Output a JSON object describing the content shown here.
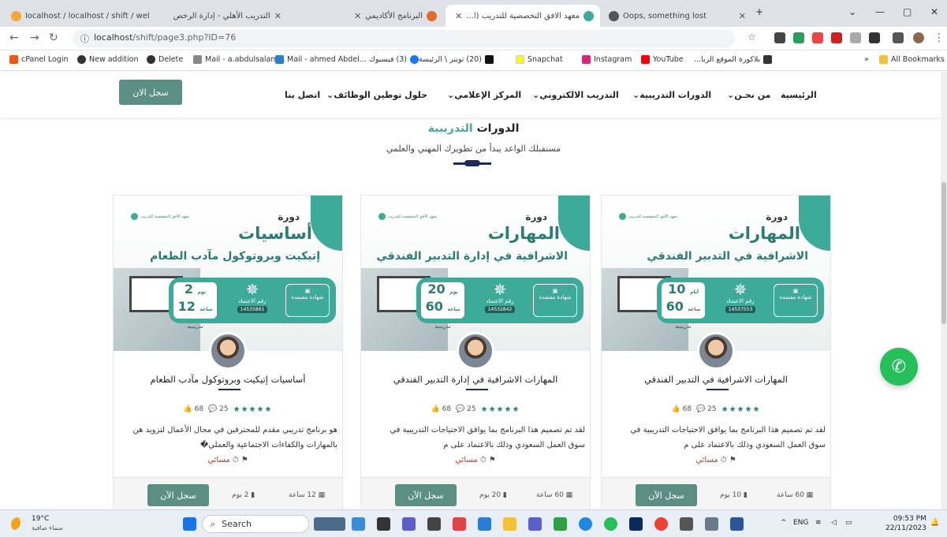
{
  "browser": {
    "tabs": [
      {
        "title": "localhost / localhost / shift / wel",
        "fav": "#f3a93a"
      },
      {
        "title": "التدريب الأهلي - إدارة الرخص",
        "fav": "#888"
      },
      {
        "title": "البرنامج الأكاديمي",
        "fav": "#e36b2c"
      },
      {
        "title": "معهد الافق التخصصية للتدريب (ا...",
        "fav": "#3eaa9a"
      },
      {
        "title": "Oops, something lost",
        "fav": "#555"
      }
    ],
    "url_host": "localhost",
    "url_path": "/shift/page3.php?ID=76",
    "bookmarks": [
      "cPanel Login",
      "New addition",
      "Delete",
      "Mail - a.abdulsalam...",
      "Mail - ahmed Abdel...",
      "(3) فيسبوك",
      "(20) تويتر \\ الرئيسة",
      "Snapchat",
      "Instagram",
      "YouTube",
      "بلاكورة الموقع الربا..."
    ],
    "bookmark_colors": [
      "#e8591a",
      "#333",
      "#333",
      "#555",
      "#2b7cd3",
      "#1877f2",
      "#111",
      "#fffc00",
      "#d62976",
      "#ff0000",
      "#333"
    ],
    "all_bookmarks": "All Bookmarks",
    "more": "»"
  },
  "site": {
    "menu": [
      "الرئيسية",
      "من نحـن",
      "الدورات التدريبية",
      "التدريب الالكتروني",
      "المركز الإعلامي",
      "حلول توطين الوظائف",
      "اتصل بنا"
    ],
    "register": "سجل الان",
    "heading_a": "الدورات",
    "heading_b": "التدريبية",
    "subheading": "مستقبلك الواعد يبدأ من تطويرك المهني والعلمي"
  },
  "cards": [
    {
      "b_title": "المهارات",
      "b_sub": "الاشرافية في التدبير الفندقي",
      "b_days": "10",
      "b_days_unit": "أيام",
      "b_hours": "60",
      "b_hours_unit": "ساعة تدريبية",
      "b_accr": "رقم الاعتماد",
      "b_accr_num": "14537553",
      "b_cert": "شهادة معتمدة",
      "b_dawra": "دورة",
      "b_logo": "معهد الأفق التخصصية للتدريب",
      "title": "المهارات الاشرافية في التدبير الفندقي",
      "likes": "68",
      "comments": "25",
      "stars": "★★★★★",
      "desc": "لقد تم تصميم هذا البرنامج بما يوافق الاحتياجات التدريبية في سوق العمل السعودي وذلك بالاعتماد على م",
      "time": "مسائي",
      "btn": "سجل الآن",
      "days": "10 يوم",
      "hours": "60 ساعة"
    },
    {
      "b_title": "المهارات",
      "b_sub": "الاشرافية في إدارة التدبير الفندقي",
      "b_days": "20",
      "b_days_unit": "يوم",
      "b_hours": "60",
      "b_hours_unit": "ساعة تدريبية",
      "b_accr": "رقم الاعتماد",
      "b_accr_num": "14532842",
      "b_cert": "شهادة معتمدة",
      "b_dawra": "دورة",
      "b_logo": "معهد الأفق التخصصية للتدريب",
      "title": "المهارات الاشرافية في إدارة التدبير الفندقي",
      "likes": "68",
      "comments": "25",
      "stars": "★★★★★",
      "desc": "لقد تم تصميم هذا البرنامج بما يوافق الاحتياجات التدريبية في سوق العمل السعودي وذلك بالاعتماد على م",
      "time": "مسائي",
      "btn": "سجل الآن",
      "days": "20 يوم",
      "hours": "60 ساعة"
    },
    {
      "b_title": "أساسيات",
      "b_sub": "إتيكيت وبروتوكول مآدب الطعام",
      "b_days": "2",
      "b_days_unit": "يوم",
      "b_hours": "12",
      "b_hours_unit": "ساعة تدريبية",
      "b_accr": "رقم الاعتماد",
      "b_accr_num": "14535861",
      "b_cert": "شهادة معتمدة",
      "b_dawra": "دورة",
      "b_logo": "معهد الأفق التخصصية للتدريب",
      "title": "أساسيات إتيكيت وبروتوكول مآدب الطعام",
      "likes": "68",
      "comments": "25",
      "stars": "★★★★★",
      "desc": "هو برنامج تدريبي مقدم للمحترفين في مجال الأعمال لتزويد هن بالمهارات والكفاءات الاجتماعية والعملي�",
      "time": "مسائي",
      "btn": "سجل الآن",
      "days": "2 يوم",
      "hours": "12 ساعة"
    }
  ],
  "taskbar": {
    "temp": "19°C",
    "weather": "سماء صافية",
    "search": "Search",
    "lang": "ENG",
    "time": "09:53 PM",
    "date": "22/11/2023"
  }
}
